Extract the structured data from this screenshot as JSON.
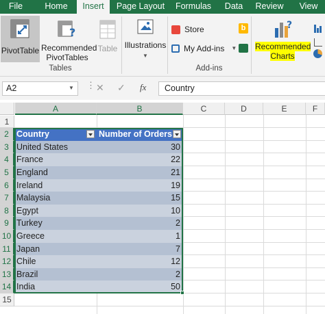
{
  "tabs": [
    {
      "label": "File",
      "active": false
    },
    {
      "label": "Home",
      "active": false
    },
    {
      "label": "Insert",
      "active": true
    },
    {
      "label": "Page Layout",
      "active": false
    },
    {
      "label": "Formulas",
      "active": false
    },
    {
      "label": "Data",
      "active": false
    },
    {
      "label": "Review",
      "active": false
    },
    {
      "label": "View",
      "active": false
    }
  ],
  "ribbon": {
    "tables": {
      "pivottable": "PivotTable",
      "recommended_line1": "Recommended",
      "recommended_line2": "PivotTables",
      "table": "Table",
      "group_label": "Tables"
    },
    "illustrations": {
      "label": "Illustrations"
    },
    "addins": {
      "store": "Store",
      "my_addins": "My Add-ins",
      "group_label": "Add-ins"
    },
    "charts": {
      "recommended_line1": "Recommended",
      "recommended_line2": "Charts"
    }
  },
  "formula_bar": {
    "name_box": "A2",
    "fx": "fx",
    "formula": "Country"
  },
  "columns": [
    "A",
    "B",
    "C",
    "D",
    "E",
    "F"
  ],
  "rows": [
    "1",
    "2",
    "3",
    "4",
    "5",
    "6",
    "7",
    "8",
    "9",
    "10",
    "11",
    "12",
    "13",
    "14",
    "15"
  ],
  "table": {
    "headers": [
      "Country",
      "Number of Orders"
    ],
    "data": [
      {
        "country": "United States",
        "orders": "30"
      },
      {
        "country": "France",
        "orders": "22"
      },
      {
        "country": "England",
        "orders": "21"
      },
      {
        "country": "Ireland",
        "orders": "19"
      },
      {
        "country": "Malaysia",
        "orders": "15"
      },
      {
        "country": "Egypt",
        "orders": "10"
      },
      {
        "country": "Turkey",
        "orders": "2"
      },
      {
        "country": "Greece",
        "orders": "1"
      },
      {
        "country": "Japan",
        "orders": "7"
      },
      {
        "country": "Chile",
        "orders": "12"
      },
      {
        "country": "Brazil",
        "orders": "2"
      },
      {
        "country": "India",
        "orders": "50"
      }
    ]
  },
  "colors": {
    "excel_green": "#217346",
    "table_header": "#4472c4",
    "band_dark": "#b4c0d2",
    "band_light": "#cad2de",
    "highlight": "#ffff00"
  }
}
